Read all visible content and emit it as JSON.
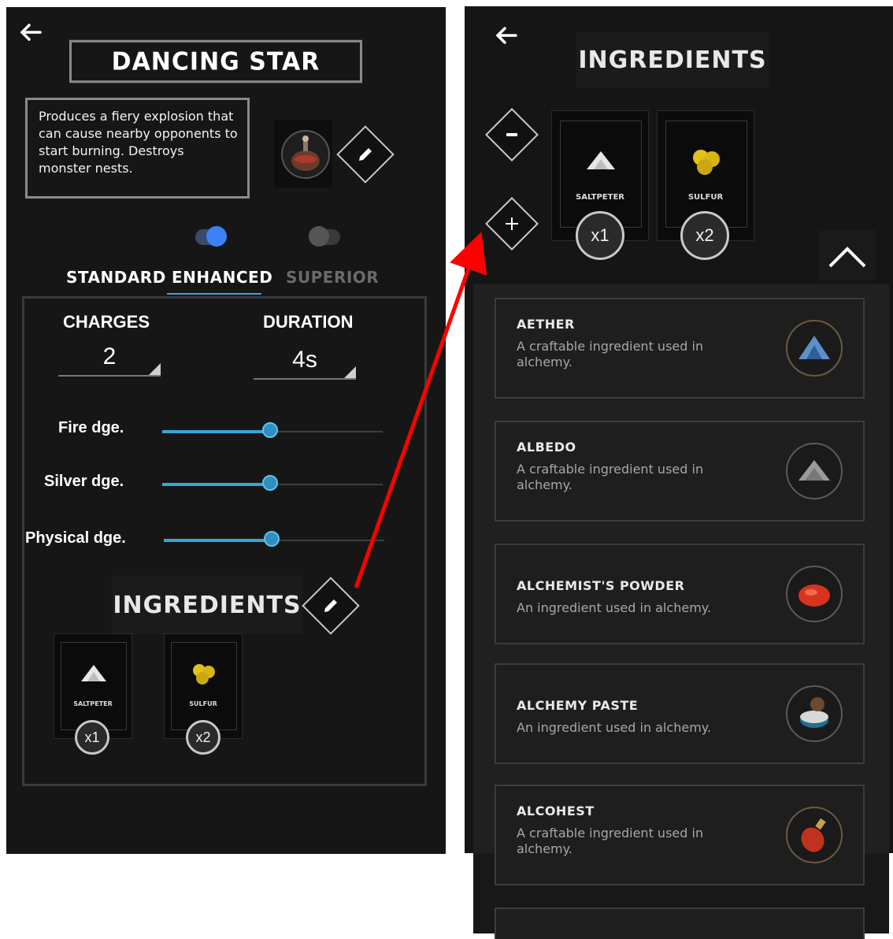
{
  "left": {
    "title": "DANCING STAR",
    "description": "Produces a fiery explosion that can cause nearby opponents to start burning. Destroys monster nests.",
    "tabs": [
      {
        "label": "STANDARD",
        "color": "#ffffff"
      },
      {
        "label": "ENHANCED",
        "color": "#ffffff"
      },
      {
        "label": "SUPERIOR",
        "color": "#6b6b6b"
      }
    ],
    "toggles": [
      {
        "state": "on",
        "color": "#3b82f6"
      },
      {
        "state": "off",
        "color": "#444444"
      }
    ],
    "charges": {
      "label": "CHARGES",
      "value": "2"
    },
    "duration": {
      "label": "DURATION",
      "value": "4s"
    },
    "sliders": [
      {
        "label": "Fire dge.",
        "level": 0.49
      },
      {
        "label": "Silver dge.",
        "level": 0.49
      },
      {
        "label": "Physical dge.",
        "level": 0.49
      }
    ],
    "ingredients_title": "INGREDIENTS",
    "ingredients": [
      {
        "name": "SALTPETER",
        "qty": "x1",
        "icon": "saltpeter-icon"
      },
      {
        "name": "SULFUR",
        "qty": "x2",
        "icon": "sulfur-icon"
      }
    ]
  },
  "right": {
    "title": "INGREDIENTS",
    "ingredients": [
      {
        "name": "SALTPETER",
        "qty": "x1",
        "icon": "saltpeter-icon"
      },
      {
        "name": "SULFUR",
        "qty": "x2",
        "icon": "sulfur-icon"
      }
    ],
    "list": [
      {
        "name": "AETHER",
        "desc": "A craftable ingredient used in alchemy.",
        "icon": "aether-icon"
      },
      {
        "name": "ALBEDO",
        "desc": "A craftable ingredient used in alchemy.",
        "icon": "albedo-icon"
      },
      {
        "name": "ALCHEMIST'S POWDER",
        "desc": "An ingredient used in alchemy.",
        "icon": "alchemists-powder-icon"
      },
      {
        "name": "ALCHEMY PASTE",
        "desc": "An ingredient used in alchemy.",
        "icon": "alchemy-paste-icon"
      },
      {
        "name": "ALCOHEST",
        "desc": "A craftable ingredient used in alchemy.",
        "icon": "alcohest-icon"
      }
    ]
  },
  "colors": {
    "accent": "#3aa5d6",
    "arrow": "#ff0000"
  }
}
